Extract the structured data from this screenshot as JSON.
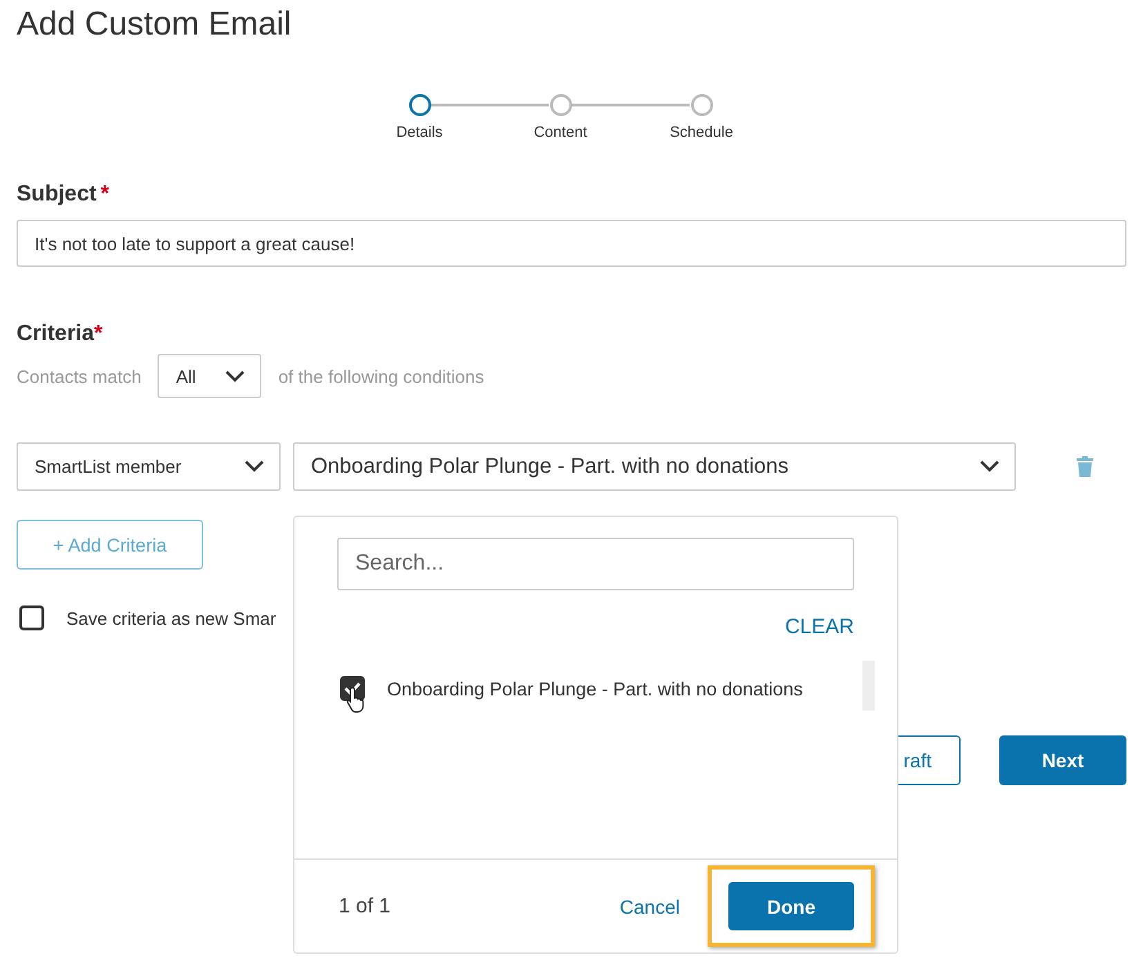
{
  "page": {
    "title": "Add Custom Email"
  },
  "steps": [
    {
      "label": "Details",
      "selected": true
    },
    {
      "label": "Content",
      "selected": false
    },
    {
      "label": "Schedule",
      "selected": false
    }
  ],
  "subject": {
    "label": "Subject",
    "required_mark": "*",
    "value": "It's not too late to support a great cause!"
  },
  "criteria": {
    "label": "Criteria",
    "required_mark": "*",
    "match_prefix": "Contacts match",
    "match_value": "All",
    "match_suffix": "of the following conditions",
    "rows": [
      {
        "field": "SmartList member",
        "value": "Onboarding Polar Plunge - Part. with no donations"
      }
    ],
    "add_button": "+ Add Criteria",
    "save_option": {
      "label": "Save criteria as new Smar",
      "checked": false
    }
  },
  "footer_buttons": [
    {
      "label": "raft",
      "kind": "outline"
    },
    {
      "label": "Next",
      "kind": "primary"
    }
  ],
  "dropdown": {
    "search_placeholder": "Search...",
    "clear": "CLEAR",
    "options": [
      {
        "label": "Onboarding Polar Plunge - Part. with no donations",
        "checked": true
      }
    ],
    "count": "1 of 1",
    "cancel": "Cancel",
    "done": "Done",
    "done_highlighted": true
  }
}
